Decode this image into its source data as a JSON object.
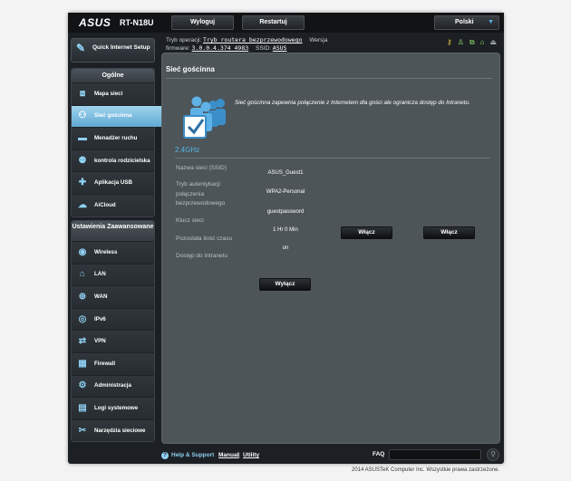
{
  "header": {
    "logo": "ASUS",
    "model": "RT-N18U",
    "logout": "Wyloguj",
    "restart": "Restartuj",
    "language": "Polski"
  },
  "infobar": {
    "op_mode_label": "Tryb operacji:",
    "op_mode_value": "Tryb routera bezprzewodowego",
    "version_label": "Wersja",
    "firmware_label": "firmware:",
    "firmware_value": "3.0.0.4.374_4983",
    "ssid_label": "SSID:",
    "ssid_value": "ASUS"
  },
  "sidebar": {
    "qis": "Quick Internet Setup",
    "general_title": "Ogólne",
    "general": [
      {
        "label": "Mapa sieci",
        "icon": "network-map-icon"
      },
      {
        "label": "Sieć gościnna",
        "icon": "guest-network-icon"
      },
      {
        "label": "Menadżer ruchu",
        "icon": "traffic-manager-icon"
      },
      {
        "label": "kontrola rodzicielska",
        "icon": "parental-control-icon"
      },
      {
        "label": "Aplikacja USB",
        "icon": "usb-icon"
      },
      {
        "label": "AiCloud",
        "icon": "cloud-icon"
      }
    ],
    "advanced_title": "Ustawienia Zaawansowane",
    "advanced": [
      {
        "label": "Wireless",
        "icon": "wireless-icon"
      },
      {
        "label": "LAN",
        "icon": "lan-icon"
      },
      {
        "label": "WAN",
        "icon": "wan-icon"
      },
      {
        "label": "IPv6",
        "icon": "ipv6-icon"
      },
      {
        "label": "VPN",
        "icon": "vpn-icon"
      },
      {
        "label": "Firewall",
        "icon": "firewall-icon"
      },
      {
        "label": "Administracja",
        "icon": "admin-icon"
      },
      {
        "label": "Logi systemowe",
        "icon": "syslog-icon"
      },
      {
        "label": "Narzędzia sieciowe",
        "icon": "network-tools-icon"
      }
    ]
  },
  "main": {
    "title": "Sieć gościnna",
    "description": "Sieć gościnna zapewnia połączenie z Internetem dla gości ale ogranicza dostęp do Intranetu.",
    "band": "2.4GHz",
    "labels": {
      "network_name": "Nazwa sieci (SSID)",
      "auth_mode": "Tryb autentykacji połączenia bezprzewodowego",
      "network_key": "Klucz sieci",
      "time_remaining": "Pozostała ilość czasu",
      "intranet_access": "Dostęp do Intranetu"
    },
    "guest1": {
      "ssid": "ASUS_Guest1",
      "auth": "WPA2-Personal",
      "key": "guestpassword",
      "time": "1 Hr 0 Min",
      "intranet": "on",
      "button": "Wyłącz"
    },
    "guest2_button": "Włącz",
    "guest3_button": "Włącz"
  },
  "footer": {
    "help": "Help & Support",
    "manual": "Manual",
    "separator": "|",
    "utility": "Utility",
    "faq": "FAQ",
    "copyright": "2014 ASUSTeK Computer Inc. Wszystkie prawa zastrzeżone."
  },
  "colors": {
    "accent": "#55b6e8",
    "active_nav": "#6eb3da",
    "content_bg": "#4d5559"
  }
}
